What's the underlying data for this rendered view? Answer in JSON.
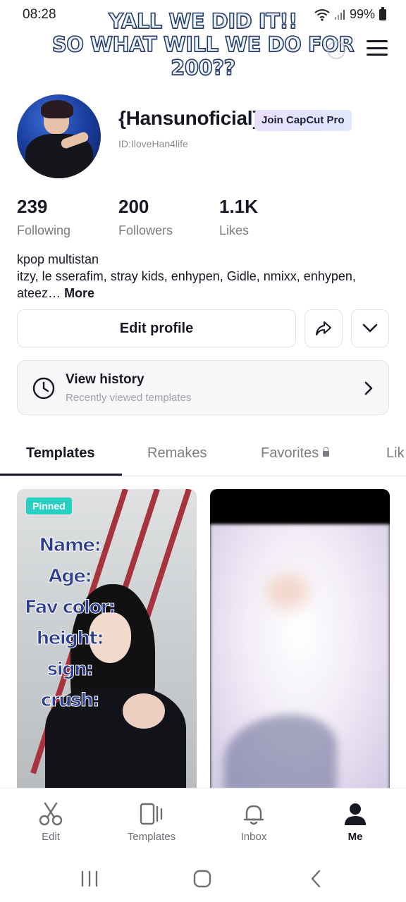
{
  "status_bar": {
    "time": "08:28",
    "battery": "99%"
  },
  "overlay_caption": {
    "line1": "YALL WE DID IT!!",
    "line2": "SO WHAT WILL WE DO FOR",
    "line3": "200??"
  },
  "profile": {
    "username": "{Hansunoficial}",
    "pro_badge": "Join CapCut Pro",
    "user_id": "ID:IloveHan4life",
    "stats": [
      {
        "value": "239",
        "label": "Following"
      },
      {
        "value": "200",
        "label": "Followers"
      },
      {
        "value": "1.1K",
        "label": "Likes"
      }
    ],
    "bio_line1": "kpop multistan",
    "bio_line2": "itzy, le sserafim, stray kids, enhypen, Gidle, nmixx, enhypen,",
    "bio_line3": "ateez…",
    "bio_more": "More"
  },
  "actions": {
    "edit_profile": "Edit profile"
  },
  "history": {
    "title": "View history",
    "subtitle": "Recently viewed templates"
  },
  "tabs": [
    "Templates",
    "Remakes",
    "Favorites",
    "Lik"
  ],
  "active_tab": "Templates",
  "templates": [
    {
      "pinned_label": "Pinned",
      "text_lines": [
        "Name:",
        "Age:",
        "Fav color:",
        "height:",
        "sign:",
        "crush:"
      ]
    },
    {}
  ],
  "bottom_nav": [
    {
      "label": "Edit",
      "icon": "scissors-icon"
    },
    {
      "label": "Templates",
      "icon": "templates-icon"
    },
    {
      "label": "Inbox",
      "icon": "bell-icon"
    },
    {
      "label": "Me",
      "icon": "person-icon"
    }
  ],
  "active_nav": "Me",
  "colors": {
    "pinned": "#26d1c4",
    "text_primary": "#161823",
    "text_secondary": "#7b7c82"
  }
}
